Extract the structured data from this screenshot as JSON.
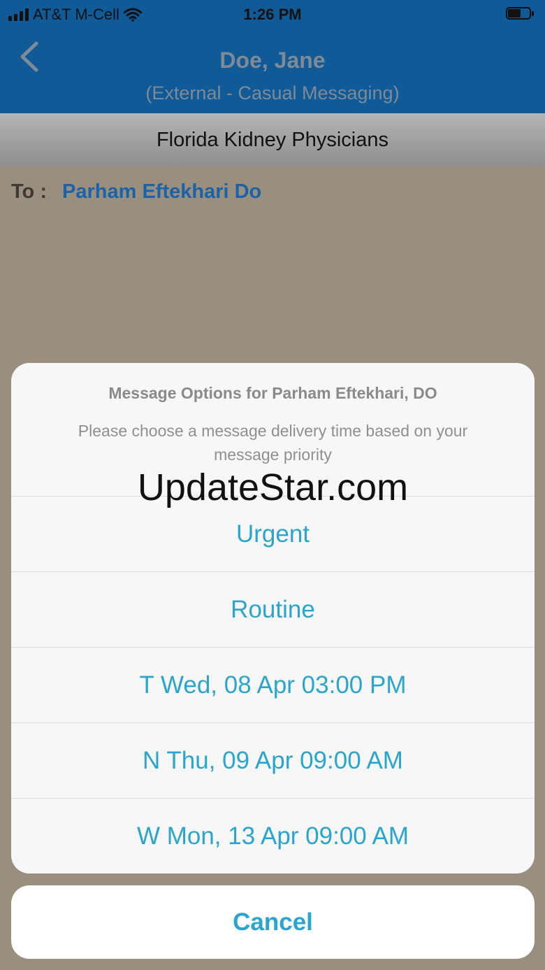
{
  "status_bar": {
    "carrier": "AT&T M-Cell",
    "time": "1:26 PM"
  },
  "nav": {
    "title": "Doe, Jane",
    "subtitle": "(External - Casual Messaging)"
  },
  "org": {
    "name": "Florida Kidney Physicians"
  },
  "recipient": {
    "label": "To :",
    "name": "Parham Eftekhari Do"
  },
  "action_sheet": {
    "title": "Message Options for Parham Eftekhari, DO",
    "message": "Please choose a message delivery time based on your message priority",
    "watermark": "UpdateStar.com",
    "options": [
      {
        "label": "Urgent"
      },
      {
        "label": "Routine"
      },
      {
        "label": "T Wed, 08 Apr 03:00 PM"
      },
      {
        "label": "N Thu, 09 Apr 09:00 AM"
      },
      {
        "label": "W Mon, 13 Apr 09:00 AM"
      }
    ],
    "cancel": "Cancel"
  },
  "colors": {
    "nav_bg": "#0f5a97",
    "accent": "#2aa5cf",
    "link": "#1a63a8"
  },
  "icons": [
    "signal-icon",
    "wifi-icon",
    "battery-icon",
    "back-chevron-icon"
  ]
}
